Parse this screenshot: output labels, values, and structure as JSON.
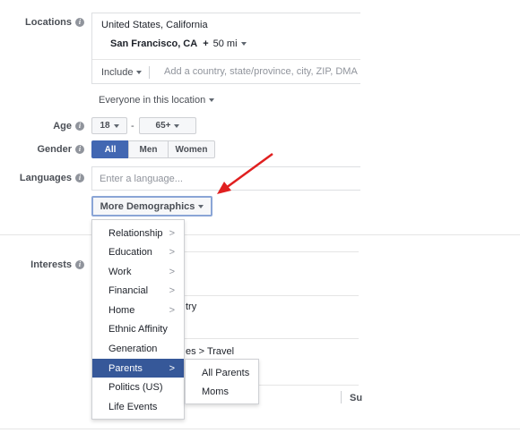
{
  "labels": {
    "locations": "Locations",
    "age": "Age",
    "gender": "Gender",
    "languages": "Languages",
    "interests": "Interests"
  },
  "locations": {
    "country": "United States, California",
    "city": "San Francisco, CA",
    "radius_prefix": "+",
    "radius": "50 mi",
    "include": "Include",
    "search_placeholder": "Add a country, state/province, city, ZIP, DMA or address",
    "everyone_text": "Everyone in this location"
  },
  "age": {
    "min": "18",
    "separator": "-",
    "max": "65+"
  },
  "gender": {
    "all": "All",
    "men": "Men",
    "women": "Women"
  },
  "languages": {
    "placeholder": "Enter a language..."
  },
  "more_demographics": "More Demographics",
  "menu": {
    "items": [
      "Relationship",
      "Education",
      "Work",
      "Financial",
      "Home",
      "Ethnic Affinity",
      "Generation",
      "Parents",
      "Politics (US)",
      "Life Events"
    ],
    "selected": "Parents"
  },
  "submenu": {
    "items": [
      "All Parents",
      "Moms"
    ]
  },
  "partial": {
    "try": "try",
    "travel": "es > Travel",
    "su": "Su"
  },
  "colors": {
    "accent": "#4267b2",
    "arrow": "#e02020"
  }
}
